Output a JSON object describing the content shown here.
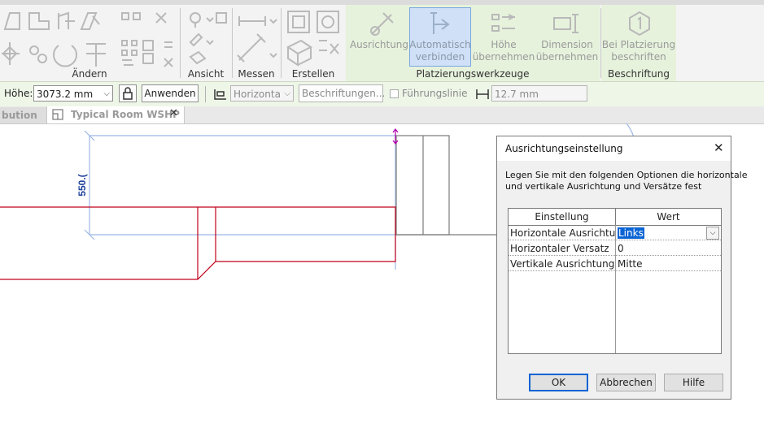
{
  "ribbon": {
    "panels": {
      "aendern": "Ändern",
      "ansicht": "Ansicht",
      "messen": "Messen",
      "erstellen": "Erstellen",
      "platzierung": "Platzierungswerkzeuge",
      "beschriftung": "Beschriftung"
    },
    "buttons": {
      "ausrichtung": "Ausrichtung",
      "auto_1": "Automatisch",
      "auto_2": "verbinden",
      "hoehe_1": "Höhe",
      "hoehe_2": "übernehmen",
      "dim_1": "Dimension",
      "dim_2": "übernehmen",
      "bei_1": "Bei Platzierung",
      "bei_2": "beschriften"
    }
  },
  "options_bar": {
    "hoehe_label": "Höhe:",
    "hoehe_value": "3073.2 mm",
    "anwenden": "Anwenden",
    "horizontal_value": "Horizonta",
    "beschriftungen": "Beschriftungen...",
    "fuehrungslinie": "Führungslinie",
    "offset_value": "12.7 mm"
  },
  "tabs": {
    "left": "bution",
    "active": "Typical Room WSHP"
  },
  "canvas": {
    "dimension_text": "550.("
  },
  "dialog": {
    "title": "Ausrichtungseinstellung",
    "description_1": "Legen Sie mit den folgenden Optionen die horizontale",
    "description_2": "und vertikale Ausrichtung und Versätze fest",
    "col_einstellung": "Einstellung",
    "col_wert": "Wert",
    "rows": [
      {
        "setting": "Horizontale Ausrichtung",
        "value": "Links"
      },
      {
        "setting": "Horizontaler Versatz",
        "value": "0"
      },
      {
        "setting": "Vertikale Ausrichtung",
        "value": "Mitte"
      }
    ],
    "ok": "OK",
    "abbrechen": "Abbrechen",
    "hilfe": "Hilfe"
  }
}
